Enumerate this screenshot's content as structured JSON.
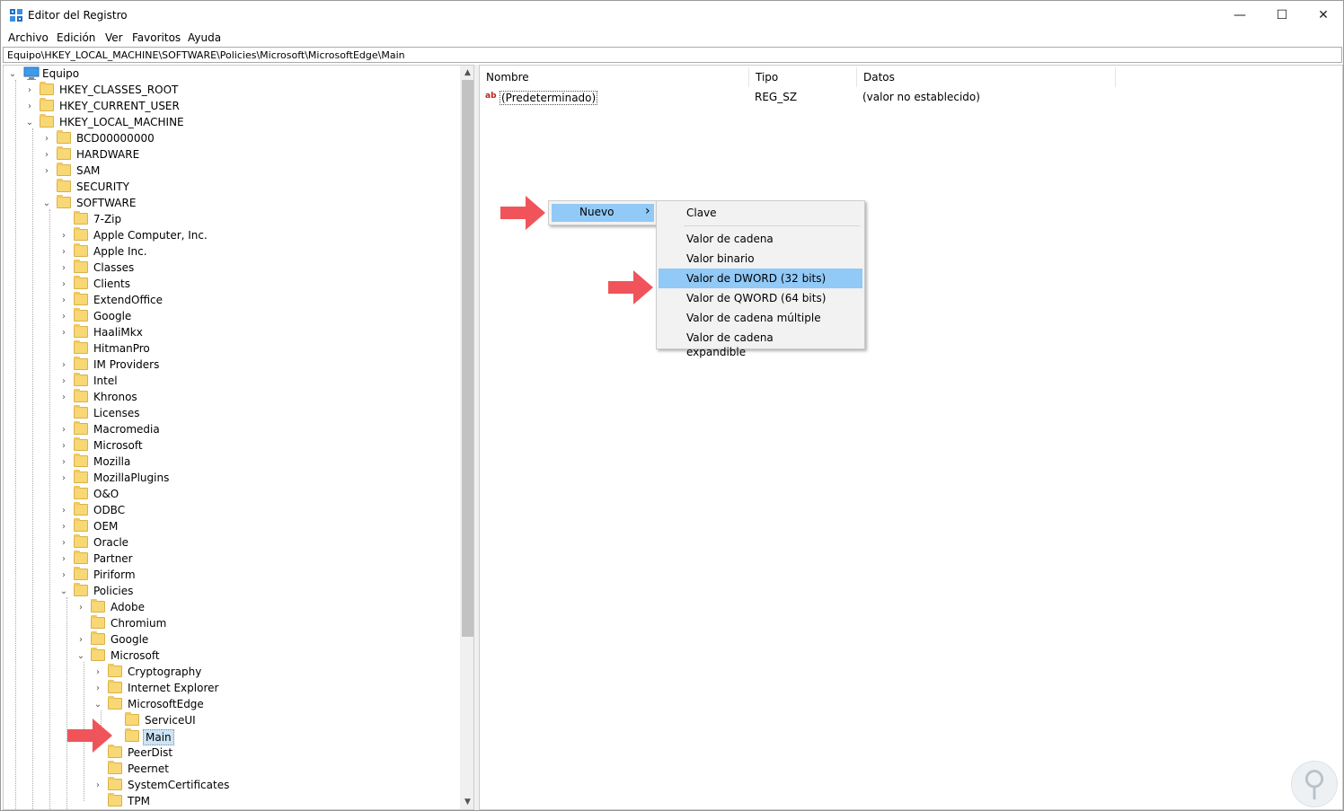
{
  "window": {
    "title": "Editor del Registro",
    "icon": "registry-editor-icon",
    "controls": {
      "minimize": "—",
      "maximize": "☐",
      "close": "✕"
    }
  },
  "menubar": {
    "items": [
      "Archivo",
      "Edición",
      "Ver",
      "Favoritos",
      "Ayuda"
    ]
  },
  "address": "Equipo\\HKEY_LOCAL_MACHINE\\SOFTWARE\\Policies\\Microsoft\\MicrosoftEdge\\Main",
  "tree": {
    "items": [
      {
        "label": "Equipo",
        "level": 0,
        "state": "expanded",
        "icon": "computer-icon"
      },
      {
        "label": "HKEY_CLASSES_ROOT",
        "level": 1,
        "state": "collapsed"
      },
      {
        "label": "HKEY_CURRENT_USER",
        "level": 1,
        "state": "collapsed"
      },
      {
        "label": "HKEY_LOCAL_MACHINE",
        "level": 1,
        "state": "expanded"
      },
      {
        "label": "BCD00000000",
        "level": 2,
        "state": "collapsed"
      },
      {
        "label": "HARDWARE",
        "level": 2,
        "state": "collapsed"
      },
      {
        "label": "SAM",
        "level": 2,
        "state": "collapsed"
      },
      {
        "label": "SECURITY",
        "level": 2,
        "state": "none"
      },
      {
        "label": "SOFTWARE",
        "level": 2,
        "state": "expanded"
      },
      {
        "label": "7-Zip",
        "level": 3,
        "state": "none"
      },
      {
        "label": "Apple Computer, Inc.",
        "level": 3,
        "state": "collapsed"
      },
      {
        "label": "Apple Inc.",
        "level": 3,
        "state": "collapsed"
      },
      {
        "label": "Classes",
        "level": 3,
        "state": "collapsed"
      },
      {
        "label": "Clients",
        "level": 3,
        "state": "collapsed"
      },
      {
        "label": "ExtendOffice",
        "level": 3,
        "state": "collapsed"
      },
      {
        "label": "Google",
        "level": 3,
        "state": "collapsed"
      },
      {
        "label": "HaaliMkx",
        "level": 3,
        "state": "collapsed"
      },
      {
        "label": "HitmanPro",
        "level": 3,
        "state": "none"
      },
      {
        "label": "IM Providers",
        "level": 3,
        "state": "collapsed"
      },
      {
        "label": "Intel",
        "level": 3,
        "state": "collapsed"
      },
      {
        "label": "Khronos",
        "level": 3,
        "state": "collapsed"
      },
      {
        "label": "Licenses",
        "level": 3,
        "state": "none"
      },
      {
        "label": "Macromedia",
        "level": 3,
        "state": "collapsed"
      },
      {
        "label": "Microsoft",
        "level": 3,
        "state": "collapsed"
      },
      {
        "label": "Mozilla",
        "level": 3,
        "state": "collapsed"
      },
      {
        "label": "MozillaPlugins",
        "level": 3,
        "state": "collapsed"
      },
      {
        "label": "O&O",
        "level": 3,
        "state": "none"
      },
      {
        "label": "ODBC",
        "level": 3,
        "state": "collapsed"
      },
      {
        "label": "OEM",
        "level": 3,
        "state": "collapsed"
      },
      {
        "label": "Oracle",
        "level": 3,
        "state": "collapsed"
      },
      {
        "label": "Partner",
        "level": 3,
        "state": "collapsed"
      },
      {
        "label": "Piriform",
        "level": 3,
        "state": "collapsed"
      },
      {
        "label": "Policies",
        "level": 3,
        "state": "expanded"
      },
      {
        "label": "Adobe",
        "level": 4,
        "state": "collapsed"
      },
      {
        "label": "Chromium",
        "level": 4,
        "state": "none"
      },
      {
        "label": "Google",
        "level": 4,
        "state": "collapsed"
      },
      {
        "label": "Microsoft",
        "level": 4,
        "state": "expanded"
      },
      {
        "label": "Cryptography",
        "level": 5,
        "state": "collapsed"
      },
      {
        "label": "Internet Explorer",
        "level": 5,
        "state": "collapsed"
      },
      {
        "label": "MicrosoftEdge",
        "level": 5,
        "state": "expanded"
      },
      {
        "label": "ServiceUI",
        "level": 6,
        "state": "none"
      },
      {
        "label": "Main",
        "level": 6,
        "state": "none",
        "selected": true
      },
      {
        "label": "PeerDist",
        "level": 5,
        "state": "none"
      },
      {
        "label": "Peernet",
        "level": 5,
        "state": "none"
      },
      {
        "label": "SystemCertificates",
        "level": 5,
        "state": "collapsed"
      },
      {
        "label": "TPM",
        "level": 5,
        "state": "none"
      }
    ]
  },
  "list": {
    "columns": [
      "Nombre",
      "Tipo",
      "Datos"
    ],
    "rows": [
      {
        "name": "(Predeterminado)",
        "type": "REG_SZ",
        "data": "(valor no establecido)",
        "icon": "string-value-icon"
      }
    ]
  },
  "context_menu": {
    "nuevo_label": "Nuevo",
    "submenu_arrow": "›",
    "submenu": {
      "items": [
        "Clave",
        "Valor de cadena",
        "Valor binario",
        "Valor de DWORD (32 bits)",
        "Valor de QWORD (64 bits)",
        "Valor de cadena múltiple",
        "Valor de cadena expandible"
      ],
      "highlighted": "Valor de DWORD (32 bits)"
    }
  },
  "colors": {
    "highlight": "#91c9f7",
    "arrow": "#f0545a",
    "folder": "#f8d775"
  }
}
